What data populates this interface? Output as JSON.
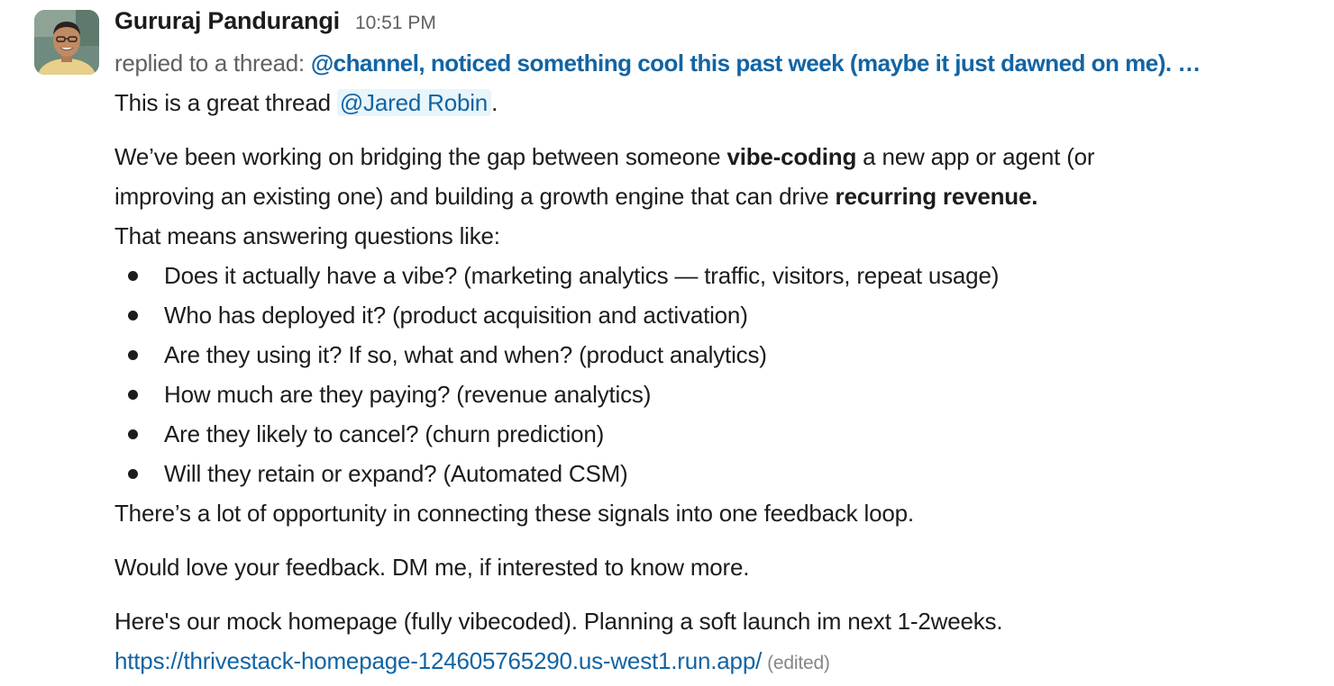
{
  "message": {
    "sender": "Gururaj Pandurangi",
    "timestamp": "10:51 PM",
    "reply_prefix": "replied to a thread:",
    "reply_link": "@channel, noticed something cool this past week (maybe it just dawned on me). …",
    "intro_prefix": "This is a great thread ",
    "mention": "@Jared Robin",
    "intro_suffix": ".",
    "para1": {
      "line1_a": "We’ve been working on bridging the gap between someone ",
      "line1_bold": "vibe-coding",
      "line1_b": " a new app or agent (or",
      "line2_a": "improving an existing one) and building a growth engine that can drive ",
      "line2_bold": "recurring revenue.",
      "line3": "That means answering questions like:"
    },
    "bullets": [
      "Does it actually have a vibe? (marketing analytics — traffic, visitors, repeat usage)",
      "Who has deployed it? (product acquisition and activation)",
      "Are they using it? If so, what and when? (product analytics)",
      "How much are they paying? (revenue analytics)",
      "Are they likely to cancel? (churn prediction)",
      "Will they retain or expand? (Automated CSM)"
    ],
    "after_bullets": "There’s a lot of opportunity in connecting these signals into one feedback loop.",
    "feedback": "Would love your feedback. DM me, if interested to know more.",
    "homepage_text": "Here's our mock homepage (fully vibecoded). Planning a soft launch im next 1-2weeks.",
    "url": "https://thrivestack-homepage-124605765290.us-west1.run.app/",
    "edited_label": "(edited)"
  },
  "colors": {
    "link": "#1264a3",
    "mention_bg": "#e8f5fa",
    "muted": "#616061",
    "text": "#1d1c1d"
  },
  "icons": {
    "avatar": "user-avatar-photo"
  }
}
